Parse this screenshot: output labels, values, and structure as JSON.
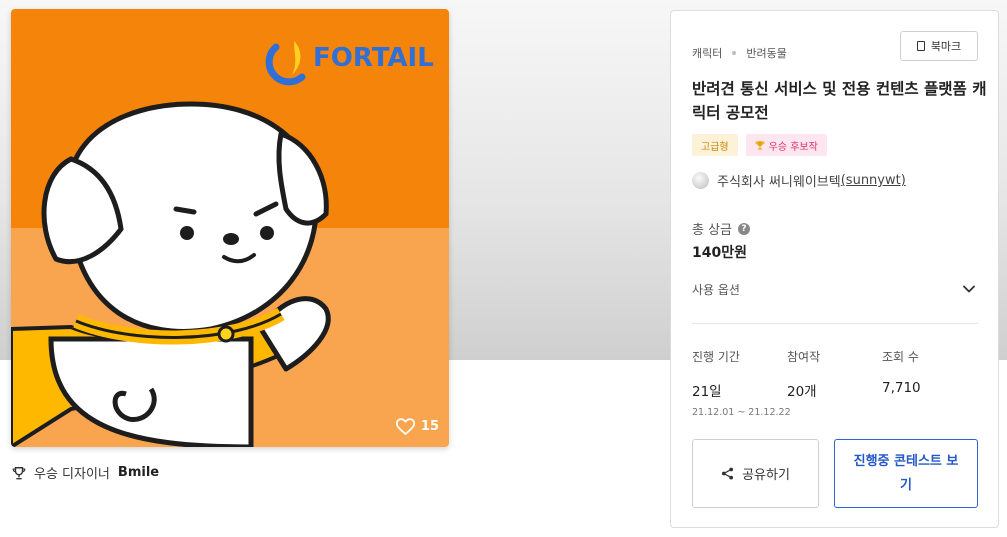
{
  "artwork": {
    "brand_logo_text": "FORTAIL",
    "like_count": "15"
  },
  "winner": {
    "label": "우승 디자이너",
    "name": "Bmile"
  },
  "panel": {
    "breadcrumb": [
      "캐릭터",
      "반려동물"
    ],
    "bookmark_label": "북마크",
    "title": "반려견 통신 서비스 및 전용 컨텐츠 플랫폼 캐릭터 공모전",
    "badges": {
      "premium": "고급형",
      "award": "우승 후보작"
    },
    "host": {
      "name": "주식회사 써니웨이브텍",
      "handle": "(sunnywt)"
    },
    "prize": {
      "label": "총 상금",
      "help": "?",
      "value": "140만원"
    },
    "options_label": "사용 옵션",
    "stats": {
      "period": {
        "label": "진행 기간",
        "value": "21일",
        "range": "21.12.01 ~ 21.12.22"
      },
      "participants": {
        "label": "참여작",
        "value": "20개"
      },
      "views": {
        "label": "조회 수",
        "value": "7,710"
      }
    },
    "share_label": "공유하기",
    "ongoing_label": "진행중 콘테스트 보기"
  },
  "colors": {
    "art_orange": "#f5840a",
    "art_light_orange": "#f9a54f",
    "logo_blue": "#2f6fd6",
    "accent_blue": "#2f64d3"
  },
  "icons": [
    "heart-icon",
    "trophy-icon",
    "bookmark-icon",
    "help-icon",
    "chevron-down-icon",
    "share-icon"
  ]
}
